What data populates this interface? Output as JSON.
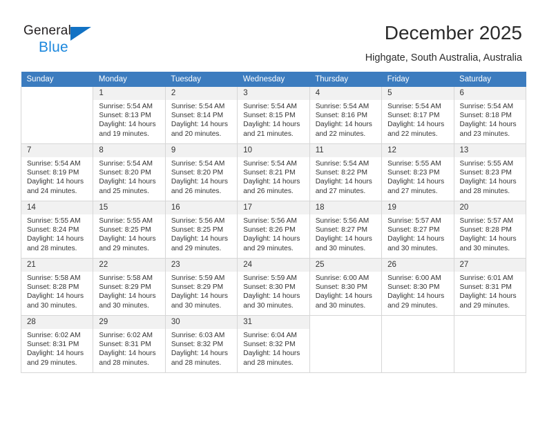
{
  "logo": {
    "word_dark": "General",
    "word_blue": "Blue",
    "triangle": "triangle-mark",
    "color_blue": "#1b87dd",
    "color_triangle": "#1272c4",
    "color_dark": "#231f20"
  },
  "header": {
    "title": "December 2025",
    "subtitle": "Highgate, South Australia, Australia"
  },
  "theme": {
    "header_row_bg": "#3c7cbf",
    "header_row_text": "#ffffff",
    "daynum_bg": "#f1f1f1",
    "grid_line": "#d6d6d6"
  },
  "calendar": {
    "weekday_headers": [
      "Sunday",
      "Monday",
      "Tuesday",
      "Wednesday",
      "Thursday",
      "Friday",
      "Saturday"
    ],
    "weeks": [
      [
        {
          "day": "",
          "sunrise": "",
          "sunset": "",
          "daylight": "",
          "empty": true
        },
        {
          "day": "1",
          "sunrise": "Sunrise: 5:54 AM",
          "sunset": "Sunset: 8:13 PM",
          "daylight": "Daylight: 14 hours and 19 minutes.",
          "empty": false
        },
        {
          "day": "2",
          "sunrise": "Sunrise: 5:54 AM",
          "sunset": "Sunset: 8:14 PM",
          "daylight": "Daylight: 14 hours and 20 minutes.",
          "empty": false
        },
        {
          "day": "3",
          "sunrise": "Sunrise: 5:54 AM",
          "sunset": "Sunset: 8:15 PM",
          "daylight": "Daylight: 14 hours and 21 minutes.",
          "empty": false
        },
        {
          "day": "4",
          "sunrise": "Sunrise: 5:54 AM",
          "sunset": "Sunset: 8:16 PM",
          "daylight": "Daylight: 14 hours and 22 minutes.",
          "empty": false
        },
        {
          "day": "5",
          "sunrise": "Sunrise: 5:54 AM",
          "sunset": "Sunset: 8:17 PM",
          "daylight": "Daylight: 14 hours and 22 minutes.",
          "empty": false
        },
        {
          "day": "6",
          "sunrise": "Sunrise: 5:54 AM",
          "sunset": "Sunset: 8:18 PM",
          "daylight": "Daylight: 14 hours and 23 minutes.",
          "empty": false
        }
      ],
      [
        {
          "day": "7",
          "sunrise": "Sunrise: 5:54 AM",
          "sunset": "Sunset: 8:19 PM",
          "daylight": "Daylight: 14 hours and 24 minutes.",
          "empty": false
        },
        {
          "day": "8",
          "sunrise": "Sunrise: 5:54 AM",
          "sunset": "Sunset: 8:20 PM",
          "daylight": "Daylight: 14 hours and 25 minutes.",
          "empty": false
        },
        {
          "day": "9",
          "sunrise": "Sunrise: 5:54 AM",
          "sunset": "Sunset: 8:20 PM",
          "daylight": "Daylight: 14 hours and 26 minutes.",
          "empty": false
        },
        {
          "day": "10",
          "sunrise": "Sunrise: 5:54 AM",
          "sunset": "Sunset: 8:21 PM",
          "daylight": "Daylight: 14 hours and 26 minutes.",
          "empty": false
        },
        {
          "day": "11",
          "sunrise": "Sunrise: 5:54 AM",
          "sunset": "Sunset: 8:22 PM",
          "daylight": "Daylight: 14 hours and 27 minutes.",
          "empty": false
        },
        {
          "day": "12",
          "sunrise": "Sunrise: 5:55 AM",
          "sunset": "Sunset: 8:23 PM",
          "daylight": "Daylight: 14 hours and 27 minutes.",
          "empty": false
        },
        {
          "day": "13",
          "sunrise": "Sunrise: 5:55 AM",
          "sunset": "Sunset: 8:23 PM",
          "daylight": "Daylight: 14 hours and 28 minutes.",
          "empty": false
        }
      ],
      [
        {
          "day": "14",
          "sunrise": "Sunrise: 5:55 AM",
          "sunset": "Sunset: 8:24 PM",
          "daylight": "Daylight: 14 hours and 28 minutes.",
          "empty": false
        },
        {
          "day": "15",
          "sunrise": "Sunrise: 5:55 AM",
          "sunset": "Sunset: 8:25 PM",
          "daylight": "Daylight: 14 hours and 29 minutes.",
          "empty": false
        },
        {
          "day": "16",
          "sunrise": "Sunrise: 5:56 AM",
          "sunset": "Sunset: 8:25 PM",
          "daylight": "Daylight: 14 hours and 29 minutes.",
          "empty": false
        },
        {
          "day": "17",
          "sunrise": "Sunrise: 5:56 AM",
          "sunset": "Sunset: 8:26 PM",
          "daylight": "Daylight: 14 hours and 29 minutes.",
          "empty": false
        },
        {
          "day": "18",
          "sunrise": "Sunrise: 5:56 AM",
          "sunset": "Sunset: 8:27 PM",
          "daylight": "Daylight: 14 hours and 30 minutes.",
          "empty": false
        },
        {
          "day": "19",
          "sunrise": "Sunrise: 5:57 AM",
          "sunset": "Sunset: 8:27 PM",
          "daylight": "Daylight: 14 hours and 30 minutes.",
          "empty": false
        },
        {
          "day": "20",
          "sunrise": "Sunrise: 5:57 AM",
          "sunset": "Sunset: 8:28 PM",
          "daylight": "Daylight: 14 hours and 30 minutes.",
          "empty": false
        }
      ],
      [
        {
          "day": "21",
          "sunrise": "Sunrise: 5:58 AM",
          "sunset": "Sunset: 8:28 PM",
          "daylight": "Daylight: 14 hours and 30 minutes.",
          "empty": false
        },
        {
          "day": "22",
          "sunrise": "Sunrise: 5:58 AM",
          "sunset": "Sunset: 8:29 PM",
          "daylight": "Daylight: 14 hours and 30 minutes.",
          "empty": false
        },
        {
          "day": "23",
          "sunrise": "Sunrise: 5:59 AM",
          "sunset": "Sunset: 8:29 PM",
          "daylight": "Daylight: 14 hours and 30 minutes.",
          "empty": false
        },
        {
          "day": "24",
          "sunrise": "Sunrise: 5:59 AM",
          "sunset": "Sunset: 8:30 PM",
          "daylight": "Daylight: 14 hours and 30 minutes.",
          "empty": false
        },
        {
          "day": "25",
          "sunrise": "Sunrise: 6:00 AM",
          "sunset": "Sunset: 8:30 PM",
          "daylight": "Daylight: 14 hours and 30 minutes.",
          "empty": false
        },
        {
          "day": "26",
          "sunrise": "Sunrise: 6:00 AM",
          "sunset": "Sunset: 8:30 PM",
          "daylight": "Daylight: 14 hours and 29 minutes.",
          "empty": false
        },
        {
          "day": "27",
          "sunrise": "Sunrise: 6:01 AM",
          "sunset": "Sunset: 8:31 PM",
          "daylight": "Daylight: 14 hours and 29 minutes.",
          "empty": false
        }
      ],
      [
        {
          "day": "28",
          "sunrise": "Sunrise: 6:02 AM",
          "sunset": "Sunset: 8:31 PM",
          "daylight": "Daylight: 14 hours and 29 minutes.",
          "empty": false
        },
        {
          "day": "29",
          "sunrise": "Sunrise: 6:02 AM",
          "sunset": "Sunset: 8:31 PM",
          "daylight": "Daylight: 14 hours and 28 minutes.",
          "empty": false
        },
        {
          "day": "30",
          "sunrise": "Sunrise: 6:03 AM",
          "sunset": "Sunset: 8:32 PM",
          "daylight": "Daylight: 14 hours and 28 minutes.",
          "empty": false
        },
        {
          "day": "31",
          "sunrise": "Sunrise: 6:04 AM",
          "sunset": "Sunset: 8:32 PM",
          "daylight": "Daylight: 14 hours and 28 minutes.",
          "empty": false
        },
        {
          "day": "",
          "sunrise": "",
          "sunset": "",
          "daylight": "",
          "empty": true
        },
        {
          "day": "",
          "sunrise": "",
          "sunset": "",
          "daylight": "",
          "empty": true
        },
        {
          "day": "",
          "sunrise": "",
          "sunset": "",
          "daylight": "",
          "empty": true
        }
      ]
    ]
  }
}
